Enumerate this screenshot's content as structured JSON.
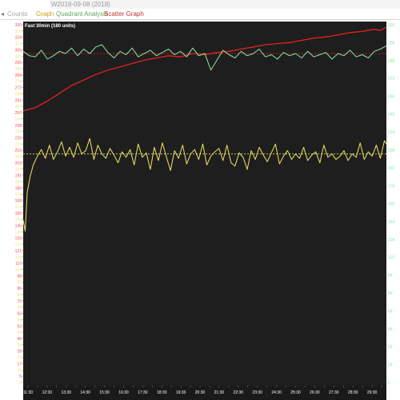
{
  "titlebar": {
    "title": "W2018-09-08 (2018)"
  },
  "tabs": {
    "scroll_left": "◂",
    "counts": "Counts",
    "graph": "Graph",
    "quadrant": "Quadrant Analysis",
    "scatter": "Scatter Graph"
  },
  "colors": {
    "plot_background": "#1e1e1e",
    "red_series": "#e32222",
    "green_series": "#8be5a8",
    "yellow_series": "#f2e56a",
    "red_axis": "#ff4a4a",
    "yellow_axis": "#f2e56a",
    "green_axis": "#8be5a8",
    "x_axis_text": "#ffffff"
  },
  "chart_data": {
    "type": "line",
    "title": "Fast 30min (180 units)",
    "x_tick_labels": [
      "11:30",
      "12:00",
      "12:30",
      "13:00",
      "13:30",
      "14:00",
      "14:30",
      "15:00",
      "15:30",
      "16:00",
      "16:30",
      "17:00",
      "17:30",
      "18:00",
      "18:30",
      "19:00",
      "19:30",
      "20:00",
      "20:30",
      "21:00",
      "21:30",
      "22:00",
      "22:30",
      "23:00",
      "23:30",
      "24:00",
      "24:30",
      "25:00",
      "25:30",
      "26:00",
      "26:30",
      "27:00",
      "27:30",
      "28:00",
      "28:30",
      "29:00",
      "29:30",
      "30:00"
    ],
    "xlim": [
      0,
      1800
    ],
    "ylim": [
      0,
      330
    ],
    "left_axis_ticks": [
      330,
      325,
      318,
      312,
      306,
      301,
      295,
      290,
      284,
      278,
      272,
      266,
      261,
      255,
      250,
      244,
      238,
      232,
      226,
      220,
      215,
      209,
      203,
      197,
      191,
      186,
      180,
      174,
      168,
      162,
      156,
      150,
      145,
      139,
      133,
      127,
      121,
      115,
      110,
      104,
      98,
      92,
      86,
      80,
      75,
      69,
      63,
      58,
      52,
      46,
      40,
      34,
      28,
      23,
      17,
      11,
      5,
      0
    ],
    "right_axis_ticks": [
      320,
      304,
      288,
      272,
      256,
      240,
      224,
      208,
      192,
      176,
      160,
      144,
      128,
      112,
      96,
      80,
      64,
      48,
      32,
      16,
      0
    ],
    "reference_lines": [
      {
        "color": "red",
        "value": 301
      },
      {
        "color": "yellow",
        "value": 210
      }
    ],
    "series": [
      {
        "color": "red",
        "x": [
          0,
          60,
          120,
          180,
          240,
          300,
          360,
          420,
          480,
          540,
          600,
          660,
          720,
          780,
          840,
          900,
          960,
          1020,
          1080,
          1140,
          1200,
          1260,
          1320,
          1380,
          1440,
          1500,
          1560,
          1620,
          1680,
          1740,
          1770,
          1800
        ],
        "values": [
          249,
          252,
          258,
          265,
          272,
          277,
          282,
          286,
          289,
          292,
          295,
          297,
          299,
          298,
          301,
          300,
          302,
          303,
          305,
          307,
          309,
          310,
          311,
          313,
          315,
          316,
          318,
          320,
          321,
          323,
          322,
          325
        ]
      },
      {
        "color": "green",
        "x": [
          0,
          30,
          60,
          90,
          120,
          150,
          180,
          210,
          240,
          270,
          300,
          330,
          360,
          390,
          420,
          450,
          480,
          510,
          540,
          570,
          600,
          630,
          660,
          690,
          720,
          750,
          780,
          810,
          840,
          870,
          900,
          930,
          960,
          990,
          1020,
          1050,
          1080,
          1110,
          1140,
          1170,
          1200,
          1230,
          1260,
          1290,
          1320,
          1350,
          1380,
          1410,
          1440,
          1470,
          1500,
          1530,
          1560,
          1590,
          1620,
          1650,
          1680,
          1710,
          1740,
          1770,
          1800
        ],
        "values": [
          303,
          299,
          298,
          304,
          296,
          299,
          303,
          301,
          306,
          299,
          305,
          301,
          307,
          309,
          302,
          297,
          303,
          300,
          306,
          298,
          301,
          304,
          299,
          302,
          305,
          300,
          303,
          298,
          306,
          299,
          301,
          286,
          295,
          304,
          300,
          297,
          303,
          299,
          301,
          305,
          298,
          300,
          296,
          302,
          299,
          301,
          297,
          303,
          298,
          300,
          302,
          296,
          301,
          299,
          304,
          298,
          300,
          297,
          303,
          305,
          308
        ]
      },
      {
        "color": "yellow",
        "x": [
          0,
          10,
          20,
          35,
          50,
          70,
          90,
          110,
          130,
          150,
          170,
          190,
          210,
          230,
          250,
          270,
          290,
          310,
          330,
          350,
          370,
          390,
          410,
          430,
          450,
          470,
          490,
          510,
          530,
          550,
          570,
          590,
          610,
          630,
          650,
          670,
          690,
          710,
          730,
          750,
          770,
          790,
          810,
          830,
          850,
          870,
          890,
          910,
          930,
          950,
          970,
          990,
          1010,
          1030,
          1050,
          1070,
          1090,
          1110,
          1130,
          1150,
          1170,
          1190,
          1210,
          1230,
          1250,
          1270,
          1290,
          1310,
          1330,
          1350,
          1370,
          1390,
          1410,
          1430,
          1450,
          1470,
          1490,
          1510,
          1530,
          1550,
          1570,
          1590,
          1610,
          1630,
          1650,
          1670,
          1690,
          1710,
          1730,
          1750,
          1770,
          1790,
          1800
        ],
        "values": [
          150,
          140,
          175,
          190,
          200,
          208,
          214,
          206,
          218,
          205,
          212,
          221,
          208,
          216,
          207,
          220,
          210,
          213,
          224,
          205,
          218,
          210,
          206,
          215,
          209,
          202,
          212,
          207,
          214,
          200,
          219,
          207,
          211,
          196,
          216,
          204,
          220,
          207,
          195,
          213,
          206,
          218,
          201,
          210,
          214,
          205,
          219,
          200,
          208,
          212,
          215,
          204,
          218,
          202,
          199,
          211,
          207,
          196,
          213,
          205,
          216,
          209,
          203,
          211,
          219,
          201,
          208,
          213,
          205,
          210,
          206,
          216,
          204,
          209,
          212,
          202,
          218,
          207,
          210,
          205,
          208,
          213,
          204,
          210,
          207,
          220,
          205,
          212,
          208,
          218,
          206,
          222,
          219
        ]
      }
    ]
  }
}
